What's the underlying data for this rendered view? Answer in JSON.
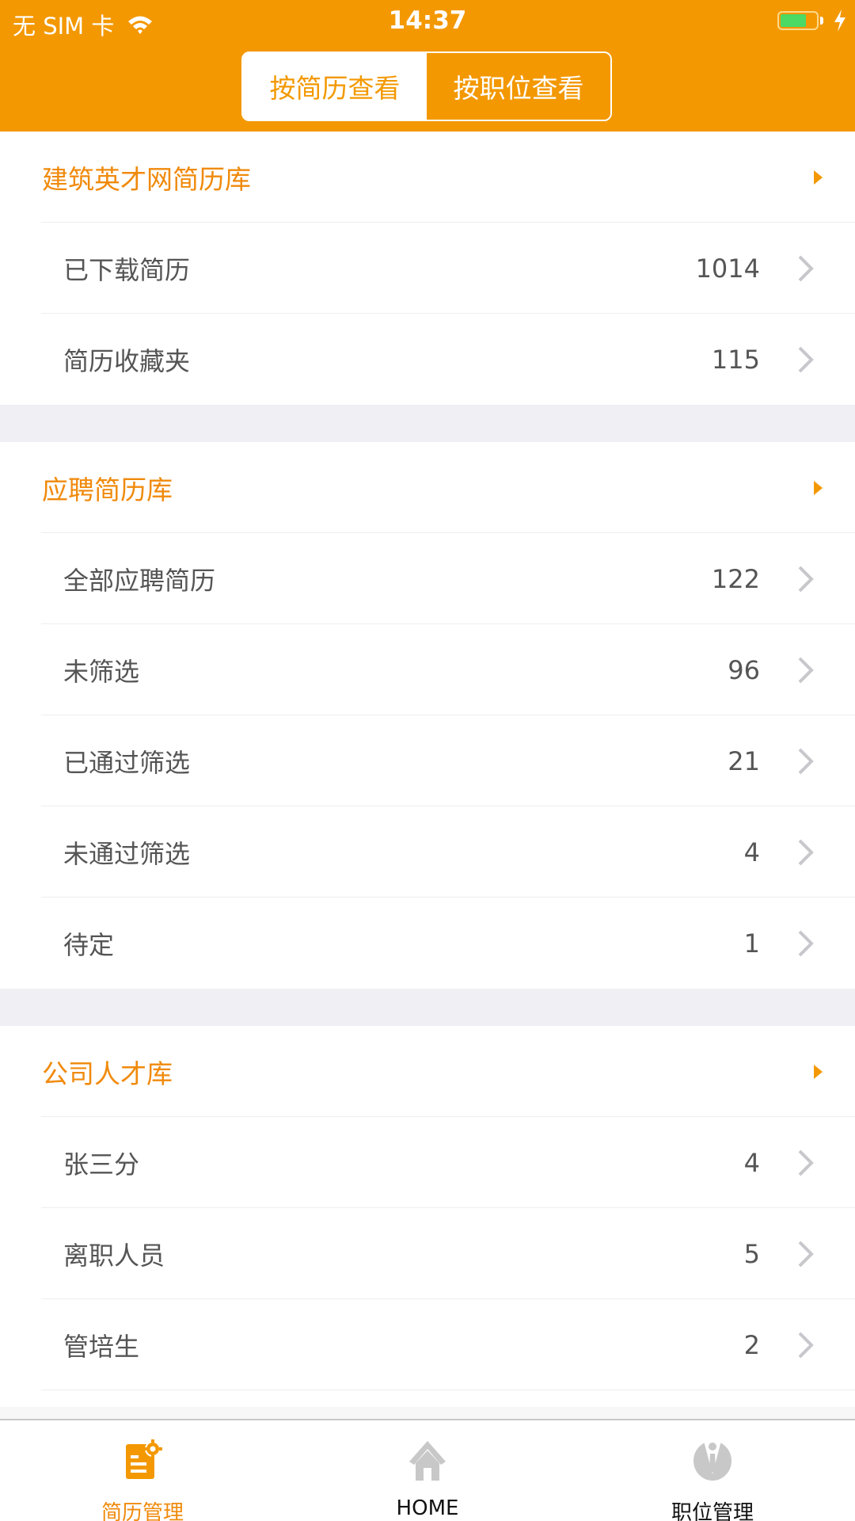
{
  "status_bar": {
    "carrier": "无 SIM 卡",
    "time": "14:37",
    "battery_level": 0.72,
    "charging": true
  },
  "segment": {
    "options": [
      {
        "label": "按简历查看",
        "selected": true
      },
      {
        "label": "按职位查看",
        "selected": false
      }
    ]
  },
  "colors": {
    "brand": "#f39800",
    "section_title": "#f08a0c",
    "item_text": "#555555",
    "background": "#efeff4"
  },
  "sections": [
    {
      "title": "建筑英才网简历库",
      "items": [
        {
          "label": "已下载简历",
          "count": "1014"
        },
        {
          "label": "简历收藏夹",
          "count": "115"
        }
      ]
    },
    {
      "title": "应聘简历库",
      "items": [
        {
          "label": "全部应聘简历",
          "count": "122"
        },
        {
          "label": "未筛选",
          "count": "96"
        },
        {
          "label": "已通过筛选",
          "count": "21"
        },
        {
          "label": "未通过筛选",
          "count": "4"
        },
        {
          "label": "待定",
          "count": "1"
        }
      ]
    },
    {
      "title": "公司人才库",
      "items": [
        {
          "label": "张三分",
          "count": "4"
        },
        {
          "label": "离职人员",
          "count": "5"
        },
        {
          "label": "管培生",
          "count": "2"
        }
      ]
    }
  ],
  "tabbar": {
    "tabs": [
      {
        "label": "简历管理",
        "icon": "resume-manage-icon",
        "active": true
      },
      {
        "label": "HOME",
        "icon": "home-icon",
        "active": false
      },
      {
        "label": "职位管理",
        "icon": "job-manage-icon",
        "active": false
      }
    ]
  }
}
